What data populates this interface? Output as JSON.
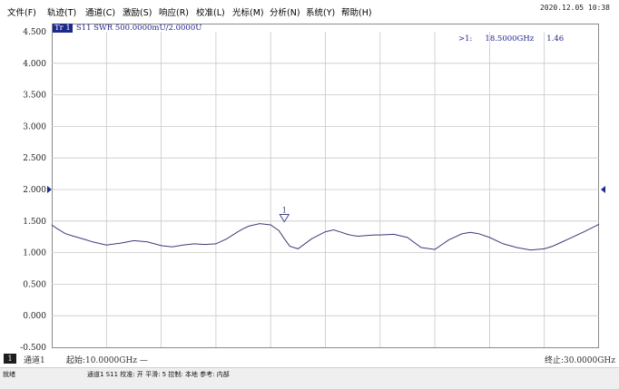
{
  "menu": [
    "文件(F)",
    "轨迹(T)",
    "通道(C)",
    "激励(S)",
    "响应(R)",
    "校准(L)",
    "光标(M)",
    "分析(N)",
    "系统(Y)",
    "帮助(H)"
  ],
  "clock": "2020.12.05 10:38",
  "trace": {
    "tag": "Tr 1",
    "desc": "S11 SWR 500.0000mU/2.0000U"
  },
  "marker": {
    "label": ">1:",
    "freq": "18.5000GHz",
    "value": "1.46",
    "marker_number": "1"
  },
  "footer": {
    "channel_number": "1",
    "channel_name": "通道1",
    "start": "起始:10.0000GHz —",
    "stop": "终止:30.0000GHz"
  },
  "status": {
    "ready": "就绪",
    "info": "通道1  S11  校准: 开  平滑: 5  控制: 本地  参考: 内部"
  },
  "colors": {
    "trace": "#3b3b7a",
    "grid": "#c8c8c8",
    "reference_arrow": "#1c2a8c"
  },
  "chart_data": {
    "type": "line",
    "ylim": [
      -0.5,
      4.5
    ],
    "y_ticks": [
      "4.500",
      "4.000",
      "3.500",
      "3.000",
      "2.500",
      "2.000",
      "1.500",
      "1.000",
      "0.500",
      "0.000",
      "-0.500"
    ],
    "reference_level": 2.0,
    "x_divisions": 10,
    "xlim": [
      10,
      30
    ],
    "x_unit": "GHz",
    "series": [
      {
        "x": [
          10.0,
          10.2,
          10.5,
          10.8,
          11.2,
          11.5,
          12.0,
          12.5,
          13.0,
          13.5,
          14.0,
          14.4,
          14.8,
          15.2,
          15.6,
          16.0,
          16.4,
          16.8,
          17.0,
          17.2,
          17.6,
          18.0,
          18.3,
          18.5,
          18.7,
          19.0,
          19.5,
          20.0,
          20.3,
          20.6,
          20.8,
          21.0,
          21.2,
          21.5,
          21.8,
          22.0,
          22.5,
          23.0,
          23.5,
          24.0,
          24.5,
          25.0,
          25.3,
          25.6,
          26.0,
          26.5,
          27.0,
          27.5,
          28.0,
          28.3,
          28.6,
          29.0,
          29.5,
          30.0
        ],
        "y": [
          1.44,
          1.38,
          1.3,
          1.26,
          1.21,
          1.17,
          1.12,
          1.15,
          1.19,
          1.17,
          1.11,
          1.09,
          1.12,
          1.14,
          1.13,
          1.14,
          1.22,
          1.33,
          1.38,
          1.42,
          1.46,
          1.44,
          1.35,
          1.22,
          1.1,
          1.06,
          1.22,
          1.33,
          1.36,
          1.32,
          1.29,
          1.27,
          1.26,
          1.27,
          1.28,
          1.28,
          1.29,
          1.24,
          1.08,
          1.05,
          1.2,
          1.3,
          1.32,
          1.3,
          1.24,
          1.14,
          1.08,
          1.04,
          1.06,
          1.1,
          1.16,
          1.24,
          1.34,
          1.45
        ]
      }
    ],
    "marker_x": 18.5,
    "marker_y": 1.46
  }
}
